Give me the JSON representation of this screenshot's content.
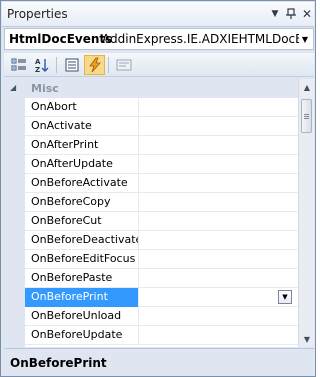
{
  "window": {
    "title": "Properties"
  },
  "object_selector": {
    "name": "HtmlDocEvents",
    "type": "AddinExpress.IE.ADXIEHTMLDocEver"
  },
  "grid": {
    "category": "Misc",
    "properties": [
      {
        "name": "OnAbort",
        "value": ""
      },
      {
        "name": "OnActivate",
        "value": ""
      },
      {
        "name": "OnAfterPrint",
        "value": ""
      },
      {
        "name": "OnAfterUpdate",
        "value": ""
      },
      {
        "name": "OnBeforeActivate",
        "value": ""
      },
      {
        "name": "OnBeforeCopy",
        "value": ""
      },
      {
        "name": "OnBeforeCut",
        "value": ""
      },
      {
        "name": "OnBeforeDeactivate",
        "value": ""
      },
      {
        "name": "OnBeforeEditFocus",
        "value": ""
      },
      {
        "name": "OnBeforePaste",
        "value": ""
      },
      {
        "name": "OnBeforePrint",
        "value": "",
        "selected": true
      },
      {
        "name": "OnBeforeUnload",
        "value": ""
      },
      {
        "name": "OnBeforeUpdate",
        "value": ""
      }
    ]
  },
  "description": {
    "title": "OnBeforePrint"
  },
  "toolbar": {
    "active_tool": "events"
  },
  "colors": {
    "selection": "#3399ff",
    "chrome": "#dfe6f1"
  }
}
